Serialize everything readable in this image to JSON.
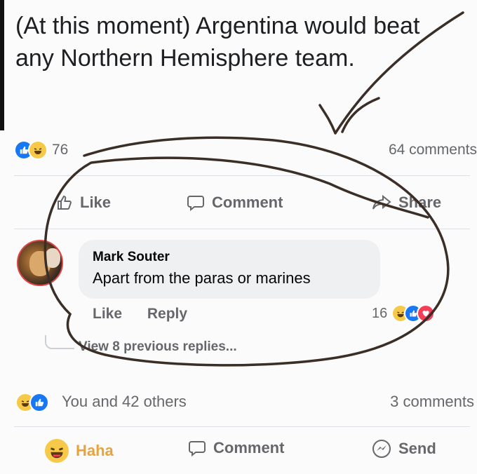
{
  "post": {
    "text": "(At this moment) Argentina would beat any Northern Hemisphere team."
  },
  "stats": {
    "reaction_icons": [
      "like-icon",
      "haha-icon"
    ],
    "reaction_count": "76",
    "comments_count": "64 comments"
  },
  "actions": {
    "like_label": "Like",
    "comment_label": "Comment",
    "share_label": "Share"
  },
  "comment": {
    "author": "Mark Souter",
    "text": "Apart from the paras or marines",
    "like_label": "Like",
    "reply_label": "Reply",
    "reaction_count": "16",
    "reaction_icons": [
      "haha-icon",
      "like-icon",
      "love-icon"
    ]
  },
  "replies": {
    "view_label": "View 8 previous replies..."
  },
  "stats2": {
    "reaction_icons": [
      "haha-icon",
      "like-icon"
    ],
    "text": "You and 42 others",
    "comments_count": "3 comments"
  },
  "actions2": {
    "haha_label": "Haha",
    "comment_label": "Comment",
    "send_label": "Send"
  },
  "colors": {
    "like": "#1877f2",
    "haha": "#f7c948",
    "love": "#f33e58",
    "haha_text": "#e8a33c",
    "annotation": "#3a2e26"
  }
}
